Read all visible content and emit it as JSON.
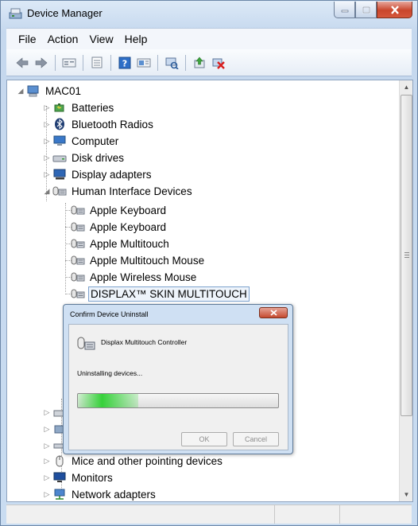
{
  "window": {
    "title": "Device Manager"
  },
  "menu": [
    "File",
    "Action",
    "View",
    "Help"
  ],
  "toolbar": {
    "buttons": [
      "back-icon",
      "forward-icon",
      "properties-view-icon",
      "list-view-icon",
      "help-icon",
      "device-view-icon",
      "scan-hardware-icon",
      "update-driver-icon",
      "uninstall-icon"
    ]
  },
  "tree": {
    "root": "MAC01",
    "items": [
      {
        "label": "Batteries",
        "icon": "battery-icon"
      },
      {
        "label": "Bluetooth Radios",
        "icon": "bluetooth-icon"
      },
      {
        "label": "Computer",
        "icon": "computer-icon"
      },
      {
        "label": "Disk drives",
        "icon": "disk-drive-icon"
      },
      {
        "label": "Display adapters",
        "icon": "display-adapter-icon"
      },
      {
        "label": "Human Interface Devices",
        "icon": "hid-icon"
      }
    ],
    "hid_children": [
      "Apple Keyboard",
      "Apple Keyboard",
      "Apple Multitouch",
      "Apple Multitouch Mouse",
      "Apple Wireless Mouse",
      "DISPLAX™ SKIN MULTITOUCH"
    ],
    "lower_items": [
      {
        "label": "Mice and other pointing devices",
        "icon": "mouse-icon"
      },
      {
        "label": "Monitors",
        "icon": "monitor-icon"
      },
      {
        "label": "Network adapters",
        "icon": "network-adapter-icon"
      }
    ]
  },
  "dialog": {
    "title": "Confirm Device Uninstall",
    "device_name": "Displax Multitouch Controller",
    "status": "Uninstalling devices...",
    "progress": 0.3,
    "ok_label": "OK",
    "cancel_label": "Cancel"
  }
}
